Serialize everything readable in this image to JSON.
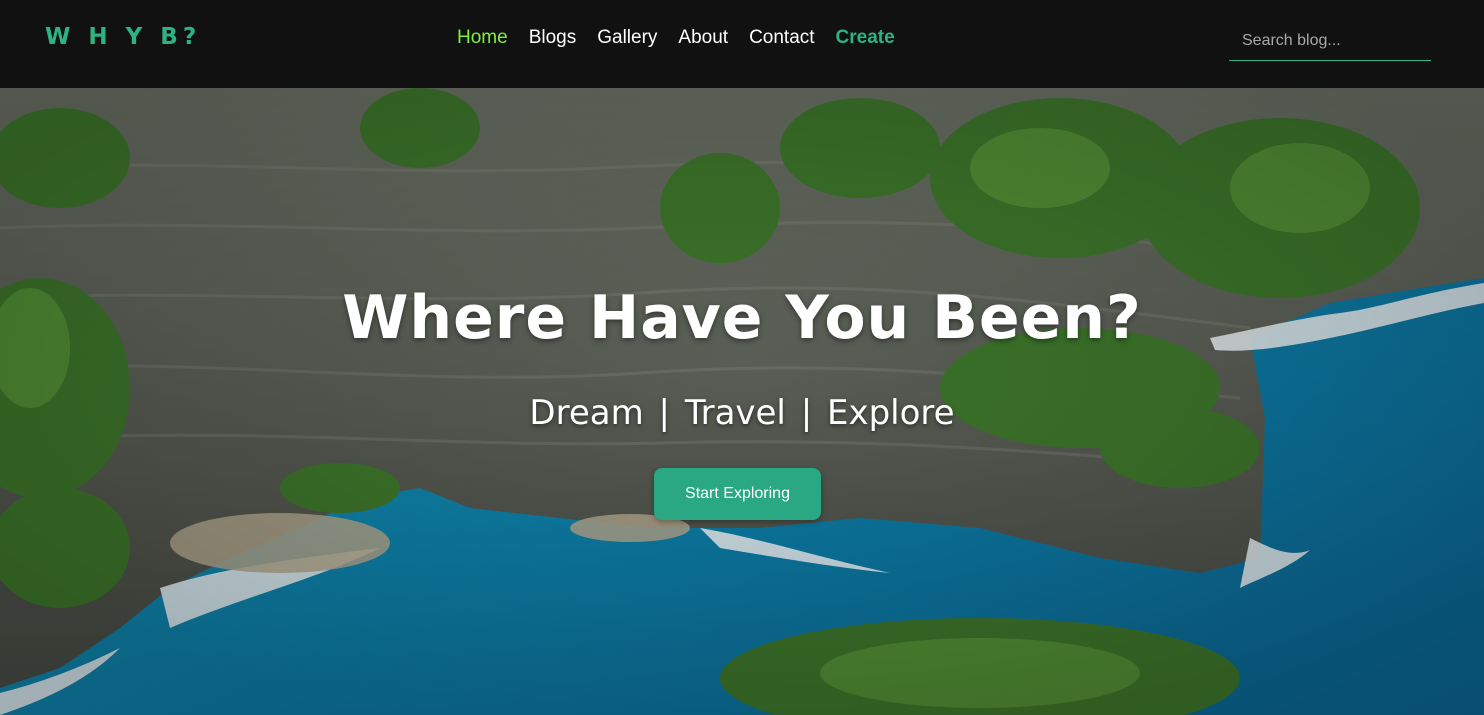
{
  "brand": {
    "name": "W H Y B?",
    "color": "#2db381"
  },
  "nav": {
    "items": [
      {
        "label": "Home",
        "state": "active"
      },
      {
        "label": "Blogs"
      },
      {
        "label": "Gallery"
      },
      {
        "label": "About"
      },
      {
        "label": "Contact"
      },
      {
        "label": "Create",
        "style": "highlight"
      }
    ],
    "active_color": "#7cf03a",
    "highlight_color": "#2db381"
  },
  "search": {
    "placeholder": "Search blog...",
    "value": ""
  },
  "hero": {
    "title": "Where Have You Been?",
    "tagline": [
      "Dream",
      "Travel",
      "Explore"
    ],
    "separator": "|",
    "cta_label": "Start Exploring",
    "cta_color": "#2aa783",
    "background": "aerial photo of cliffs and turquoise sea"
  }
}
